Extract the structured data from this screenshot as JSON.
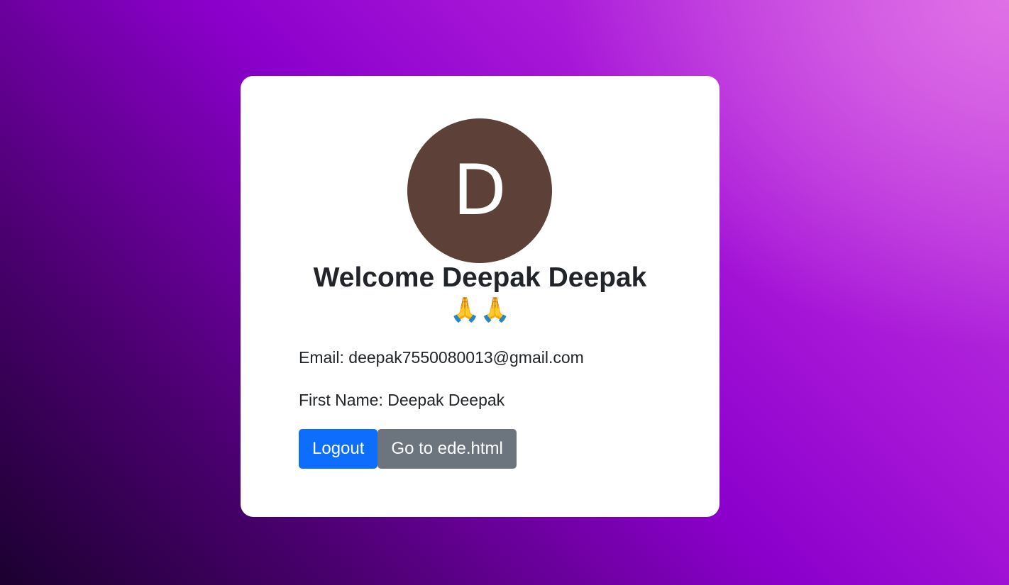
{
  "profile": {
    "avatar_initial": "D",
    "avatar_color": "#5d4037",
    "welcome_text": "Welcome Deepak Deepak",
    "welcome_emoji": "🙏🙏",
    "email_line": "Email: deepak7550080013@gmail.com",
    "first_name_line": "First Name: Deepak Deepak"
  },
  "actions": {
    "logout_label": "Logout",
    "goto_label": "Go to ede.html"
  },
  "colors": {
    "primary": "#0d6efd",
    "secondary": "#6c757d",
    "card": "#ffffff",
    "gradient_dark": "#1c0030",
    "gradient_mid": "#8c00cc",
    "gradient_light": "#e070e6"
  }
}
